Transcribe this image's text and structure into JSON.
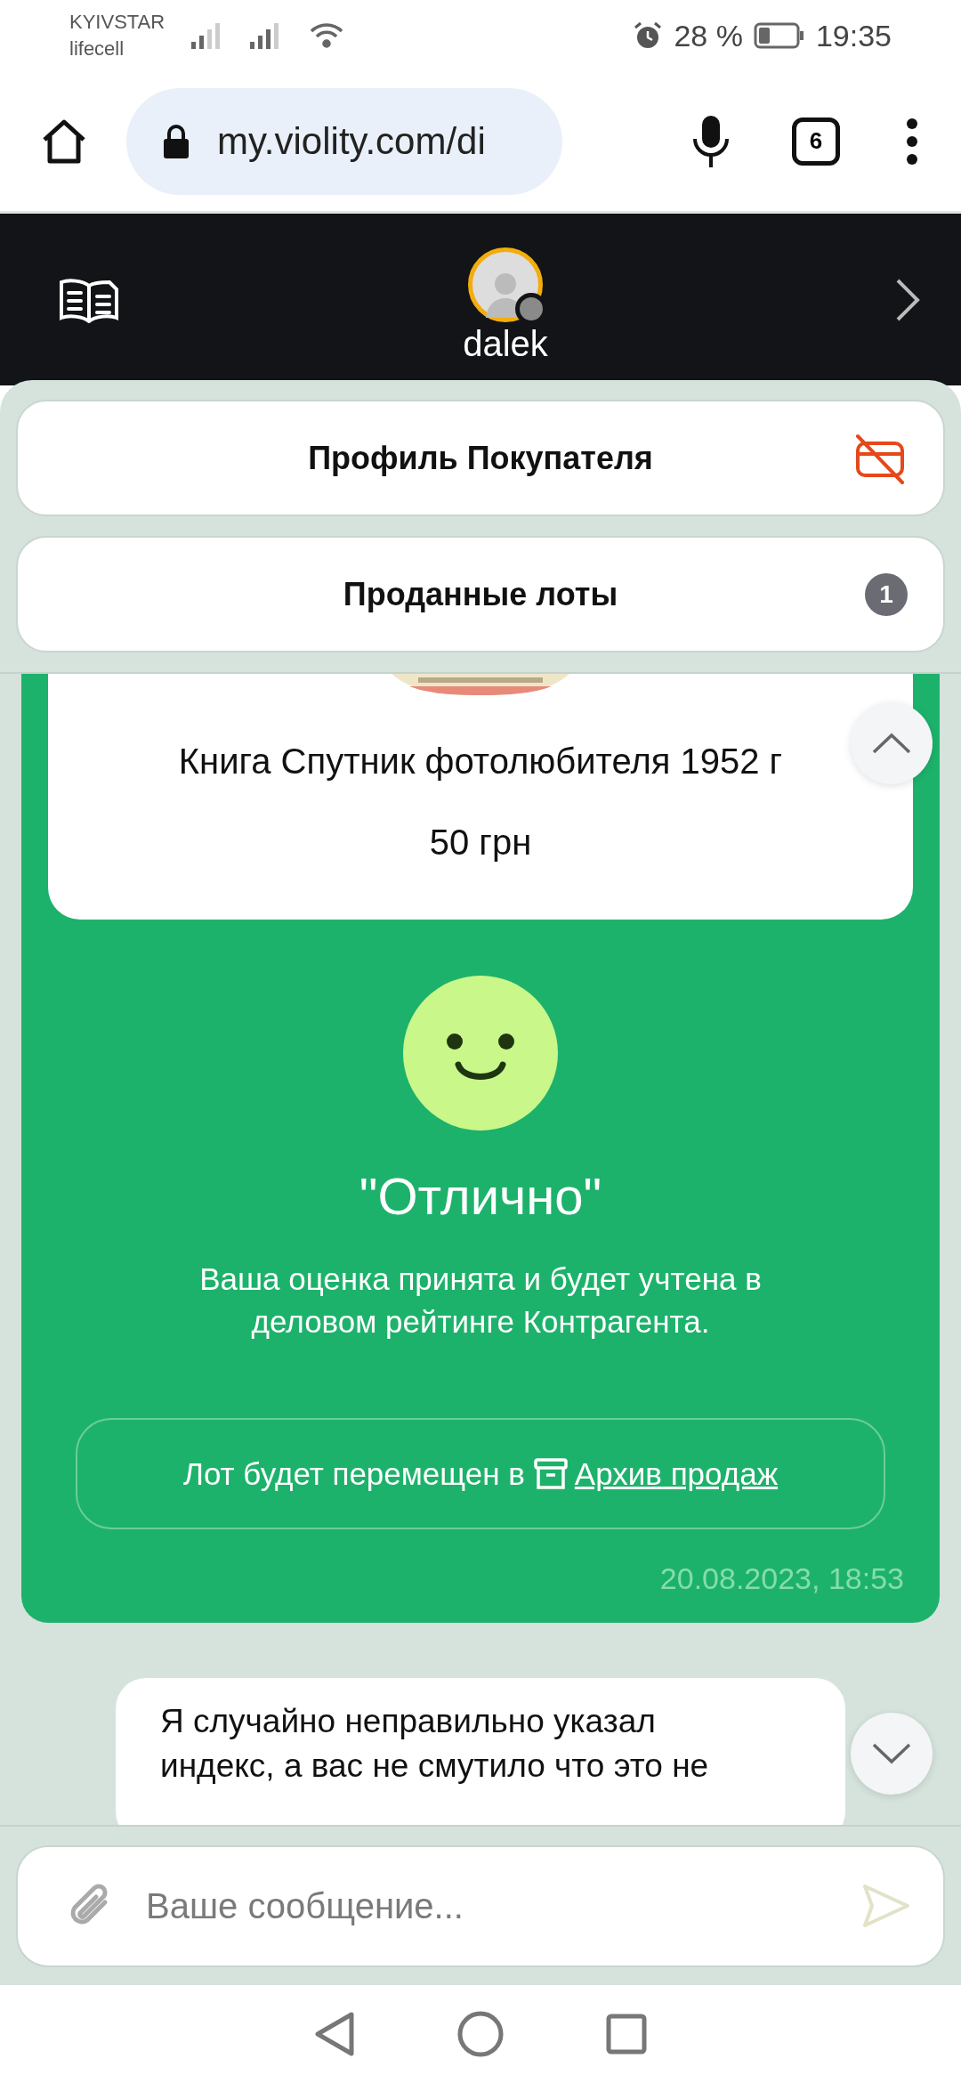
{
  "status_bar": {
    "carriers": [
      "KYIVSTAR",
      "lifecell"
    ],
    "battery": "28 %",
    "time": "19:35"
  },
  "browser": {
    "url": "my.violity.com/di",
    "tab_count": "6"
  },
  "header": {
    "username": "dalek"
  },
  "sections": [
    {
      "title": "Профиль Покупателя",
      "kind": "icon"
    },
    {
      "title": "Проданные лоты",
      "kind": "count",
      "count": "1"
    }
  ],
  "lot": {
    "kind": "picture",
    "title": "Книга Спутник фотолюбителя 1952 г",
    "price": "50 грн"
  },
  "rating": {
    "label": "\"Отлично\"",
    "note": "Ваша оценка принята и будет учтена в деловом рейтинге Контрагента.",
    "archive_prefix": "Лот будет перемещен в",
    "archive_link": "Архив продаж",
    "timestamp": "20.08.2023, 18:53"
  },
  "messages": [
    {
      "text": "Я случайно неправильно указал индекс, а вас не смутило что это не"
    }
  ],
  "composer": {
    "placeholder": "Ваше сообщение..."
  }
}
